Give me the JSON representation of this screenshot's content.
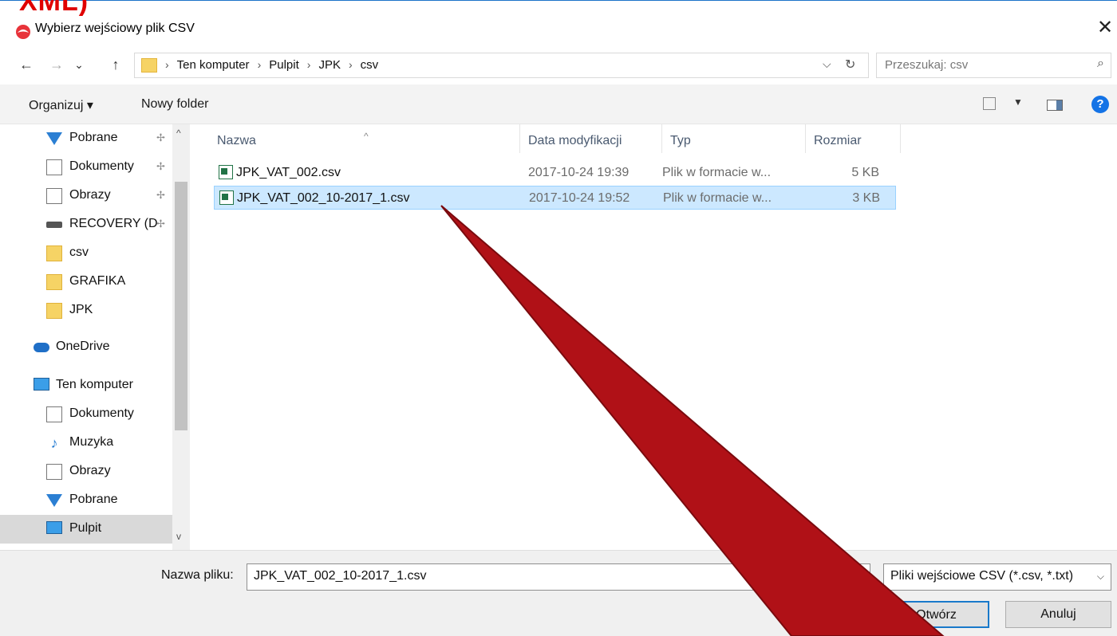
{
  "overlay": {
    "heading": "XML)"
  },
  "window": {
    "title": "Wybierz wejściowy plik CSV",
    "close_glyph": "✕"
  },
  "nav": {
    "back_glyph": "←",
    "forward_glyph": "→",
    "recent_glyph": "⌄",
    "up_glyph": "↑",
    "breadcrumbs": [
      "Ten komputer",
      "Pulpit",
      "JPK",
      "csv"
    ],
    "breadcrumb_separator": "›",
    "search_placeholder": "Przeszukaj: csv"
  },
  "toolbar": {
    "organize": "Organizuj ▾",
    "new_folder": "Nowy folder",
    "help": "?"
  },
  "sidebar": {
    "items": [
      {
        "label": "Pobrane",
        "icon": "download-icon",
        "pinned": true
      },
      {
        "label": "Dokumenty",
        "icon": "documents-icon",
        "pinned": true
      },
      {
        "label": "Obrazy",
        "icon": "pictures-icon",
        "pinned": true
      },
      {
        "label": "RECOVERY (D",
        "icon": "drive-icon",
        "pinned": true
      },
      {
        "label": "csv",
        "icon": "folder-icon"
      },
      {
        "label": "GRAFIKA",
        "icon": "folder-icon"
      },
      {
        "label": "JPK",
        "icon": "folder-icon"
      },
      {
        "label": "OneDrive",
        "icon": "onedrive-icon"
      },
      {
        "label": "Ten komputer",
        "icon": "computer-icon"
      },
      {
        "label": "Dokumenty",
        "icon": "documents-icon"
      },
      {
        "label": "Muzyka",
        "icon": "music-icon"
      },
      {
        "label": "Obrazy",
        "icon": "pictures-icon"
      },
      {
        "label": "Pobrane",
        "icon": "download-icon"
      },
      {
        "label": "Pulpit",
        "icon": "desktop-icon",
        "selected": true
      }
    ]
  },
  "filelist": {
    "columns": [
      "Nazwa",
      "Data modyfikacji",
      "Typ",
      "Rozmiar"
    ],
    "rows": [
      {
        "name": "JPK_VAT_002.csv",
        "date": "2017-10-24 19:39",
        "type": "Plik w formacie w...",
        "size": "5 KB"
      },
      {
        "name": "JPK_VAT_002_10-2017_1.csv",
        "date": "2017-10-24 19:52",
        "type": "Plik w formacie w...",
        "size": "3 KB",
        "selected": true
      }
    ]
  },
  "bottom": {
    "filename_label": "Nazwa pliku:",
    "filename_value": "JPK_VAT_002_10-2017_1.csv",
    "filetype_value": "Pliki wejściowe CSV (*.csv, *.txt)",
    "open_button": "Otwórz",
    "cancel_button": "Anuluj"
  },
  "colors": {
    "accent": "#1979ca",
    "selection": "#cce8ff",
    "annotation": "#b01117"
  }
}
